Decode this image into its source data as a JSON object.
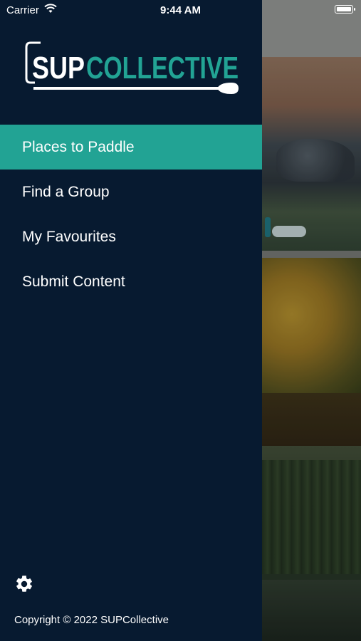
{
  "status_bar": {
    "carrier": "Carrier",
    "time": "9:44 AM"
  },
  "brand": {
    "name_part1": "SUP",
    "name_part2": "COLLECTIVE",
    "accent_color": "#22a394",
    "drawer_bg": "#071a30"
  },
  "menu": {
    "items": [
      {
        "label": "Places to Paddle",
        "active": true
      },
      {
        "label": "Find a Group",
        "active": false
      },
      {
        "label": "My Favourites",
        "active": false
      },
      {
        "label": "Submit Content",
        "active": false
      }
    ]
  },
  "footer": {
    "settings_icon": "gear-icon",
    "copyright": "Copyright © 2022 SUPCollective"
  }
}
